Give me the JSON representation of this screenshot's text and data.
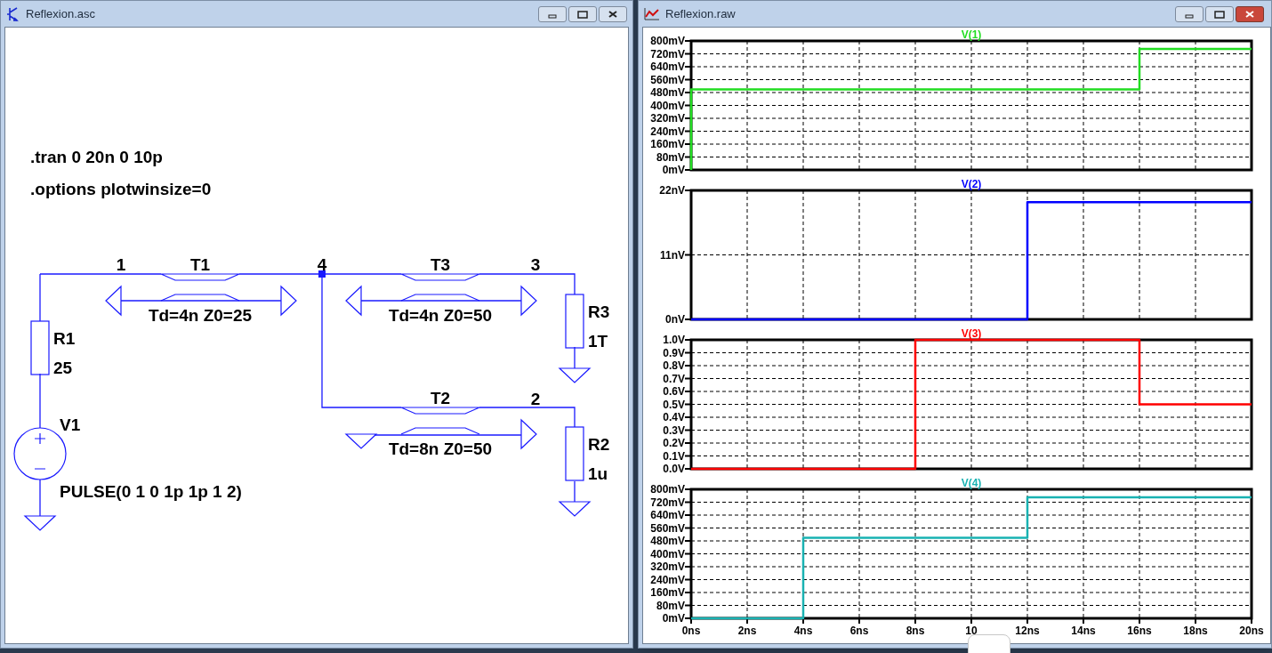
{
  "schematic_window": {
    "title": "Reflexion.asc",
    "active": false,
    "directives": [
      ".tran 0 20n 0 10p",
      ".options plotwinsize=0"
    ],
    "net_labels": [
      "1",
      "4",
      "3",
      "2"
    ],
    "components": [
      {
        "kind": "tline",
        "name": "T1",
        "value": "Td=4n Z0=25"
      },
      {
        "kind": "tline",
        "name": "T3",
        "value": "Td=4n Z0=50"
      },
      {
        "kind": "resistor",
        "name": "R3",
        "value": "1T"
      },
      {
        "kind": "resistor",
        "name": "R1",
        "value": "25"
      },
      {
        "kind": "tline",
        "name": "T2",
        "value": "Td=8n Z0=50"
      },
      {
        "kind": "resistor",
        "name": "R2",
        "value": "1u"
      },
      {
        "kind": "voltage_source",
        "name": "V1",
        "value": "PULSE(0 1 0 1p 1p 1 2)"
      }
    ]
  },
  "plot_window": {
    "title": "Reflexion.raw",
    "active": true,
    "plots": [
      {
        "chart_data": {
          "type": "line",
          "grid": true,
          "x": [
            0,
            0,
            16,
            16,
            20
          ],
          "xlim": [
            0,
            20
          ],
          "ylim": [
            0,
            800
          ],
          "yticks": [
            {
              "value": 0,
              "label": "0mV"
            },
            {
              "value": 80,
              "label": "80mV"
            },
            {
              "value": 160,
              "label": "160mV"
            },
            {
              "value": 240,
              "label": "240mV"
            },
            {
              "value": 320,
              "label": "320mV"
            },
            {
              "value": 400,
              "label": "400mV"
            },
            {
              "value": 480,
              "label": "480mV"
            },
            {
              "value": 560,
              "label": "560mV"
            },
            {
              "value": 640,
              "label": "640mV"
            },
            {
              "value": 720,
              "label": "720mV"
            },
            {
              "value": 800,
              "label": "800mV"
            }
          ],
          "series": [
            {
              "name": "V(1)",
              "color": "#22dd22",
              "values": [
                0,
                500,
                500,
                750,
                750
              ]
            }
          ]
        }
      },
      {
        "chart_data": {
          "type": "line",
          "grid": true,
          "x": [
            0,
            6,
            12,
            12,
            16,
            20
          ],
          "xlim": [
            0,
            20
          ],
          "ylim": [
            0,
            22
          ],
          "yticks": [
            {
              "value": 0,
              "label": "0nV"
            },
            {
              "value": 11,
              "label": "11nV"
            },
            {
              "value": 22,
              "label": "22nV"
            }
          ],
          "series": [
            {
              "name": "V(2)",
              "color": "#0000ff",
              "values": [
                0,
                0,
                0,
                20,
                20,
                20
              ]
            }
          ]
        }
      },
      {
        "chart_data": {
          "type": "line",
          "grid": true,
          "x": [
            0,
            8,
            8,
            16,
            16,
            20
          ],
          "xlim": [
            0,
            20
          ],
          "ylim": [
            0,
            1
          ],
          "yticks": [
            {
              "value": 0,
              "label": "0.0V"
            },
            {
              "value": 0.1,
              "label": "0.1V"
            },
            {
              "value": 0.2,
              "label": "0.2V"
            },
            {
              "value": 0.3,
              "label": "0.3V"
            },
            {
              "value": 0.4,
              "label": "0.4V"
            },
            {
              "value": 0.5,
              "label": "0.5V"
            },
            {
              "value": 0.6,
              "label": "0.6V"
            },
            {
              "value": 0.7,
              "label": "0.7V"
            },
            {
              "value": 0.8,
              "label": "0.8V"
            },
            {
              "value": 0.9,
              "label": "0.9V"
            },
            {
              "value": 1,
              "label": "1.0V"
            }
          ],
          "series": [
            {
              "name": "V(3)",
              "color": "#ff0000",
              "values": [
                0,
                0,
                1,
                1,
                0.5,
                0.5
              ]
            }
          ]
        }
      },
      {
        "chart_data": {
          "type": "line",
          "grid": true,
          "x": [
            0,
            4,
            4,
            12,
            12,
            20
          ],
          "xlim": [
            0,
            20
          ],
          "ylim": [
            0,
            800
          ],
          "xticks": [
            {
              "value": 0,
              "label": "0ns"
            },
            {
              "value": 2,
              "label": "2ns"
            },
            {
              "value": 4,
              "label": "4ns"
            },
            {
              "value": 6,
              "label": "6ns"
            },
            {
              "value": 8,
              "label": "8ns"
            },
            {
              "value": 10,
              "label": "10"
            },
            {
              "value": 12,
              "label": "12ns"
            },
            {
              "value": 14,
              "label": "14ns"
            },
            {
              "value": 16,
              "label": "16ns"
            },
            {
              "value": 18,
              "label": "18ns"
            },
            {
              "value": 20,
              "label": "20ns"
            }
          ],
          "yticks": [
            {
              "value": 0,
              "label": "0mV"
            },
            {
              "value": 80,
              "label": "80mV"
            },
            {
              "value": 160,
              "label": "160mV"
            },
            {
              "value": 240,
              "label": "240mV"
            },
            {
              "value": 320,
              "label": "320mV"
            },
            {
              "value": 400,
              "label": "400mV"
            },
            {
              "value": 480,
              "label": "480mV"
            },
            {
              "value": 560,
              "label": "560mV"
            },
            {
              "value": 640,
              "label": "640mV"
            },
            {
              "value": 720,
              "label": "720mV"
            },
            {
              "value": 800,
              "label": "800mV"
            }
          ],
          "series": [
            {
              "name": "V(4)",
              "color": "#19b2b2",
              "values": [
                0,
                0,
                500,
                500,
                750,
                750
              ]
            }
          ]
        }
      }
    ]
  }
}
